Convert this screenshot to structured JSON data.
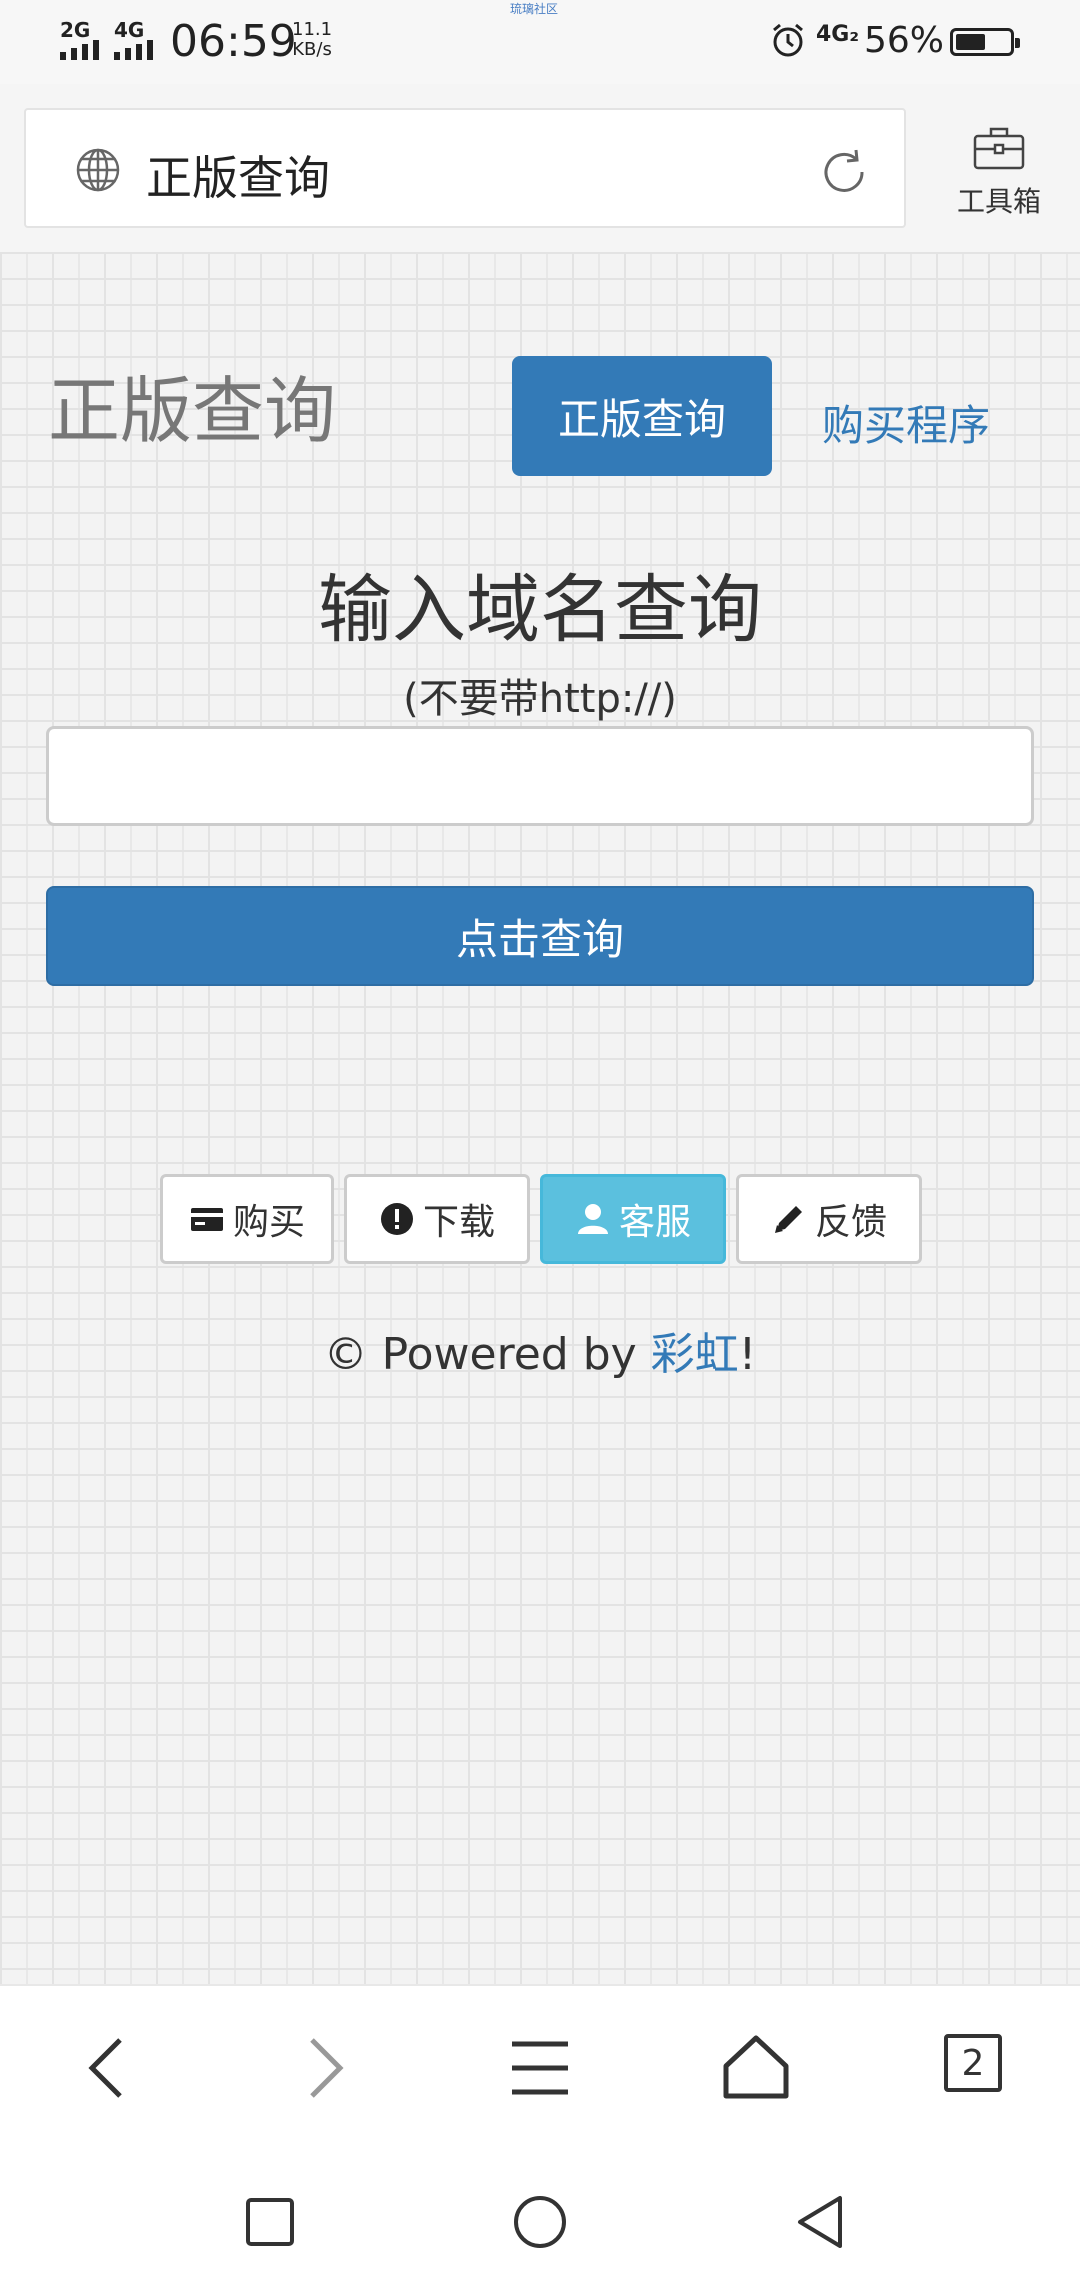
{
  "status_bar": {
    "signal1_label": "2G",
    "signal2_label": "4G",
    "time": "06:59",
    "speed_value": "11.1",
    "speed_unit": "KB/s",
    "center_text": "琉璃社区",
    "network2": "4G₂",
    "battery_percent": "56%",
    "battery_level": 0.56,
    "icons": [
      "alarm-icon",
      "battery-icon"
    ]
  },
  "address_bar": {
    "url_text": "正版查询",
    "toolbox_label": "工具箱",
    "icons": [
      "globe-icon",
      "reload-icon",
      "toolbox-icon"
    ]
  },
  "page": {
    "brand": "正版查询",
    "nav": {
      "active_label": "正版查询",
      "link_label": "购买程序"
    },
    "query_title": "输入域名查询",
    "query_hint": "(不要带http://)",
    "domain_input": {
      "value": "",
      "placeholder": ""
    },
    "submit_label": "点击查询",
    "button_group": [
      {
        "label": "购买",
        "icon": "credit-card-icon"
      },
      {
        "label": "下载",
        "icon": "exclamation-circle-icon"
      },
      {
        "label": "客服",
        "icon": "user-icon"
      },
      {
        "label": "反馈",
        "icon": "pencil-icon"
      }
    ],
    "footer": {
      "prefix": "© Powered by ",
      "link": "彩虹",
      "suffix": "!"
    }
  },
  "browser_nav": {
    "icons": [
      "back-icon",
      "forward-icon",
      "menu-icon",
      "home-icon",
      "tabs-icon"
    ],
    "tab_count": "2"
  },
  "system_nav": {
    "icons": [
      "recents-icon",
      "home-circle-icon",
      "back-triangle-icon"
    ]
  },
  "colors": {
    "primary": "#337ab7",
    "info": "#5bc0de",
    "background": "#f3f3f3"
  }
}
